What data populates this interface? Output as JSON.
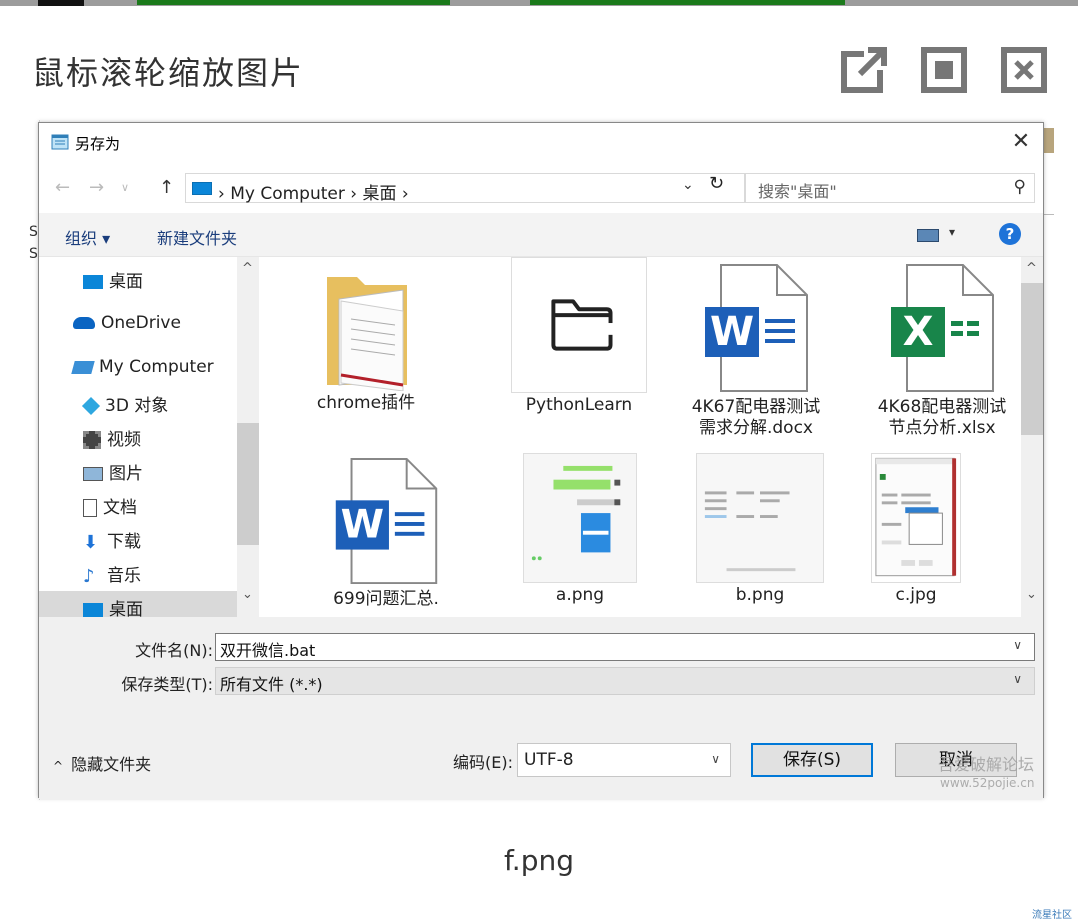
{
  "viewer": {
    "title": "鼠标滚轮缩放图片",
    "caption": "f.png",
    "footer_mark": "流星社区",
    "buttons": [
      "open-external-icon",
      "fit-screen-icon",
      "close-icon"
    ]
  },
  "background": {
    "left_fragment_1": "S",
    "left_fragment_2": "S"
  },
  "dialog": {
    "title": "另存为",
    "address": {
      "crumb_1": "My Computer",
      "crumb_2": "桌面",
      "sep": "›",
      "search_placeholder": "搜索\"桌面\""
    },
    "toolbar": {
      "organize": "组织 ▾",
      "new_folder": "新建文件夹",
      "help": "?"
    },
    "nav": {
      "items": [
        {
          "label": "桌面",
          "icon": "desktop-icon"
        },
        {
          "label": "OneDrive",
          "icon": "onedrive-icon"
        },
        {
          "label": "My Computer",
          "icon": "computer-icon"
        },
        {
          "label": "3D 对象",
          "icon": "3d-objects-icon"
        },
        {
          "label": "视频",
          "icon": "video-icon"
        },
        {
          "label": "图片",
          "icon": "pictures-icon"
        },
        {
          "label": "文档",
          "icon": "documents-icon"
        },
        {
          "label": "下载",
          "icon": "download-icon"
        },
        {
          "label": "音乐",
          "icon": "music-icon"
        },
        {
          "label": "桌面",
          "icon": "desktop-icon"
        }
      ]
    },
    "files": [
      {
        "line1": "chrome插件",
        "line2": "",
        "type": "folder"
      },
      {
        "line1": "PythonLearn",
        "line2": "",
        "type": "folder-outline"
      },
      {
        "line1": "4K67配电器测试",
        "line2": "需求分解.docx",
        "type": "word"
      },
      {
        "line1": "4K68配电器测试",
        "line2": "节点分析.xlsx",
        "type": "excel"
      },
      {
        "line1": "699问题汇总.",
        "line2": "",
        "type": "word"
      },
      {
        "line1": "a.png",
        "line2": "",
        "type": "image-chat"
      },
      {
        "line1": "b.png",
        "line2": "",
        "type": "image-settings"
      },
      {
        "line1": "c.jpg",
        "line2": "",
        "type": "image-dialog"
      }
    ],
    "form": {
      "filename_label": "文件名(N):",
      "filename_value": "双开微信.bat",
      "filetype_label": "保存类型(T):",
      "filetype_value": "所有文件 (*.*)"
    },
    "bottom": {
      "hide_folders": "隐藏文件夹",
      "encoding_label": "编码(E):",
      "encoding_value": "UTF-8",
      "save": "保存(S)",
      "cancel": "取消"
    }
  },
  "watermark": {
    "line1": "吾爱破解论坛",
    "line2": "www.52pojie.cn"
  }
}
